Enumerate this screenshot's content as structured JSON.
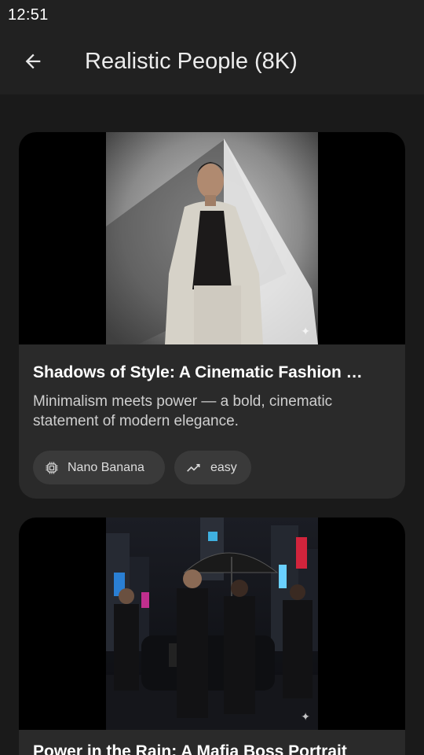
{
  "status_bar": {
    "time": "12:51"
  },
  "header": {
    "title": "Realistic People (8K)"
  },
  "cards": [
    {
      "title": "Shadows of Style: A Cinematic Fashion …",
      "description": "Minimalism meets power — a bold, cinematic statement of modern elegance.",
      "chips": [
        {
          "icon": "chip-icon",
          "label": "Nano Banana"
        },
        {
          "icon": "trending-icon",
          "label": "easy"
        }
      ]
    },
    {
      "title": "Power in the Rain: A Mafia Boss Portrait"
    }
  ]
}
